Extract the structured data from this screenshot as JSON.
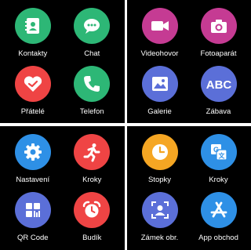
{
  "screens": [
    {
      "apps": [
        {
          "label": "Kontakty",
          "icon": "contacts-icon",
          "color": "#2db776"
        },
        {
          "label": "Chat",
          "icon": "chat-icon",
          "color": "#2db776"
        },
        {
          "label": "Přátelé",
          "icon": "friends-heart-icon",
          "color": "#ef4444"
        },
        {
          "label": "Telefon",
          "icon": "phone-icon",
          "color": "#2db776"
        }
      ]
    },
    {
      "apps": [
        {
          "label": "Videohovor",
          "icon": "video-camera-icon",
          "color": "#c53b93"
        },
        {
          "label": "Fotoaparát",
          "icon": "camera-icon",
          "color": "#c53b93"
        },
        {
          "label": "Galerie",
          "icon": "gallery-icon",
          "color": "#5b6fd8"
        },
        {
          "label": "Zábava",
          "icon": "abc-icon",
          "color": "#5b6fd8"
        }
      ]
    },
    {
      "apps": [
        {
          "label": "Nastavení",
          "icon": "gear-icon",
          "color": "#2e90e6"
        },
        {
          "label": "Kroky",
          "icon": "running-icon",
          "color": "#ef4444"
        },
        {
          "label": "QR Code",
          "icon": "qr-code-icon",
          "color": "#5b6fd8"
        },
        {
          "label": "Budík",
          "icon": "alarm-clock-icon",
          "color": "#ef4444"
        }
      ]
    },
    {
      "apps": [
        {
          "label": "Stopky",
          "icon": "stopwatch-icon",
          "color": "#f5a623"
        },
        {
          "label": "Kroky",
          "icon": "translate-icon",
          "color": "#2e90e6"
        },
        {
          "label": "Zámek obr.",
          "icon": "screen-lock-icon",
          "color": "#5b6fd8"
        },
        {
          "label": "App obchod",
          "icon": "app-store-icon",
          "color": "#2e90e6"
        }
      ]
    }
  ]
}
